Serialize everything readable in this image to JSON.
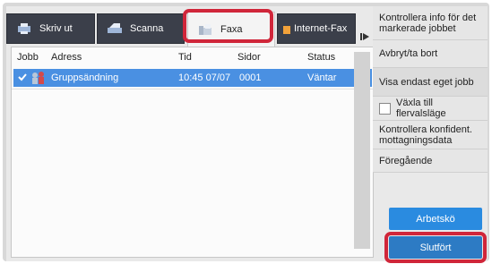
{
  "tabs": [
    {
      "label": "Skriv ut",
      "icon": "printer-icon"
    },
    {
      "label": "Scanna",
      "icon": "scanner-icon"
    },
    {
      "label": "Faxa",
      "icon": "fax-icon"
    },
    {
      "label": "Internet-Fax",
      "icon": "internet-fax-icon"
    }
  ],
  "list": {
    "columns": [
      "Jobb",
      "Adress",
      "Tid",
      "Sidor",
      "Status"
    ],
    "rows": [
      {
        "address": "Gruppsändning",
        "time": "10:45 07/07",
        "pages": "0001",
        "status": "Väntar"
      }
    ]
  },
  "sidebar": {
    "items": [
      "Kontrollera info för det markerade jobbet",
      "Avbryt/ta bort",
      "Visa endast eget jobb",
      "Växla till flervalsläge",
      "Kontrollera konfident. mottagningsdata",
      "Föregående"
    ]
  },
  "buttons": {
    "job_queue": "Arbetskö",
    "completed": "Slutfört"
  },
  "colors": {
    "highlight": "#d0263a",
    "selected_row": "#4a90e2",
    "tab_dark": "#3b3f4a",
    "button_blue": "#2d7bc4"
  }
}
